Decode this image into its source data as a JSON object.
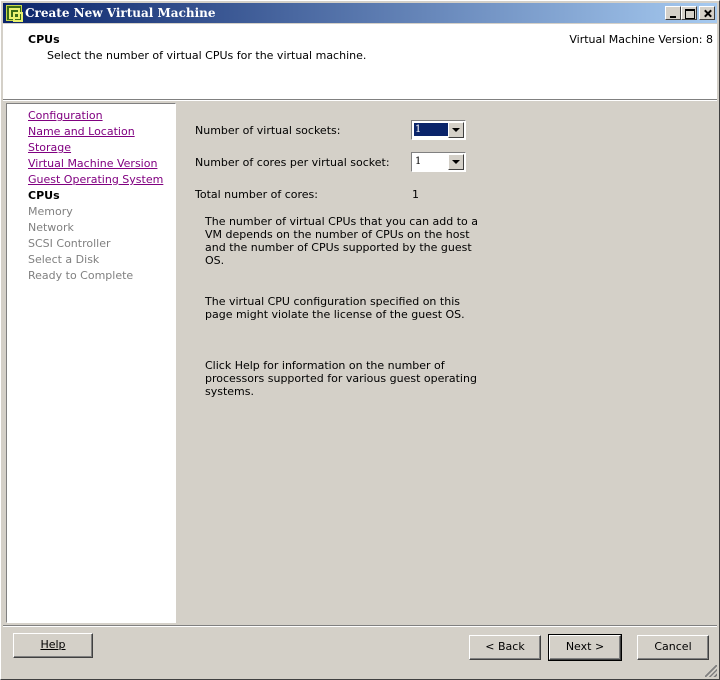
{
  "window": {
    "title": "Create New Virtual Machine"
  },
  "header": {
    "title": "CPUs",
    "subtitle": "Select the number of virtual CPUs for the virtual machine.",
    "version": "Virtual Machine Version: 8"
  },
  "nav": {
    "items": [
      {
        "label": "Configuration",
        "state": "link"
      },
      {
        "label": "Name and Location",
        "state": "link"
      },
      {
        "label": "Storage",
        "state": "link"
      },
      {
        "label": "Virtual Machine Version",
        "state": "link"
      },
      {
        "label": "Guest Operating System",
        "state": "link"
      },
      {
        "label": "CPUs",
        "state": "current"
      },
      {
        "label": "Memory",
        "state": "disabled"
      },
      {
        "label": "Network",
        "state": "disabled"
      },
      {
        "label": "SCSI Controller",
        "state": "disabled"
      },
      {
        "label": "Select a Disk",
        "state": "disabled"
      },
      {
        "label": "Ready to Complete",
        "state": "disabled"
      }
    ]
  },
  "form": {
    "sockets_label": "Number of virtual sockets:",
    "sockets_value": "1",
    "cores_label": "Number of cores per virtual socket:",
    "cores_value": "1",
    "total_label": "Total number of cores:",
    "total_value": "1"
  },
  "info": {
    "p1": "The number of virtual CPUs that you can add to a VM depends on the number of CPUs on the host and the number of CPUs supported by the guest OS.",
    "p2": "The virtual CPU configuration specified on this page might violate the license of the guest OS.",
    "p3": "Click Help for information on the number of processors supported for various guest operating systems."
  },
  "buttons": {
    "help": "Help",
    "back": "< Back",
    "next": "Next >",
    "cancel": "Cancel"
  },
  "colors": {
    "titlebar_start": "#0a246a",
    "titlebar_end": "#a6caf0",
    "link_visited": "#800080",
    "disabled_text": "#808080",
    "dialog_bg": "#d4d0c8"
  }
}
